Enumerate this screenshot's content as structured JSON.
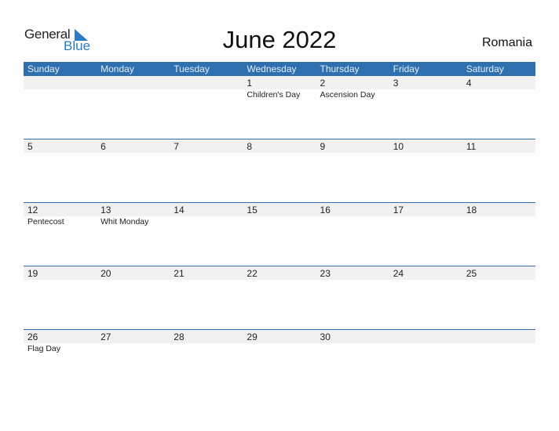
{
  "logo": {
    "line1": "General",
    "line2": "Blue"
  },
  "title": "June 2022",
  "country": "Romania",
  "colors": {
    "accent": "#2e6fb0",
    "band": "#f1f1f1",
    "logo_blue": "#2a7bc4"
  },
  "weekdays": [
    "Sunday",
    "Monday",
    "Tuesday",
    "Wednesday",
    "Thursday",
    "Friday",
    "Saturday"
  ],
  "weeks": [
    [
      {
        "day": "",
        "holiday": ""
      },
      {
        "day": "",
        "holiday": ""
      },
      {
        "day": "",
        "holiday": ""
      },
      {
        "day": "1",
        "holiday": "Children's Day"
      },
      {
        "day": "2",
        "holiday": "Ascension Day"
      },
      {
        "day": "3",
        "holiday": ""
      },
      {
        "day": "4",
        "holiday": ""
      }
    ],
    [
      {
        "day": "5",
        "holiday": ""
      },
      {
        "day": "6",
        "holiday": ""
      },
      {
        "day": "7",
        "holiday": ""
      },
      {
        "day": "8",
        "holiday": ""
      },
      {
        "day": "9",
        "holiday": ""
      },
      {
        "day": "10",
        "holiday": ""
      },
      {
        "day": "11",
        "holiday": ""
      }
    ],
    [
      {
        "day": "12",
        "holiday": "Pentecost"
      },
      {
        "day": "13",
        "holiday": "Whit Monday"
      },
      {
        "day": "14",
        "holiday": ""
      },
      {
        "day": "15",
        "holiday": ""
      },
      {
        "day": "16",
        "holiday": ""
      },
      {
        "day": "17",
        "holiday": ""
      },
      {
        "day": "18",
        "holiday": ""
      }
    ],
    [
      {
        "day": "19",
        "holiday": ""
      },
      {
        "day": "20",
        "holiday": ""
      },
      {
        "day": "21",
        "holiday": ""
      },
      {
        "day": "22",
        "holiday": ""
      },
      {
        "day": "23",
        "holiday": ""
      },
      {
        "day": "24",
        "holiday": ""
      },
      {
        "day": "25",
        "holiday": ""
      }
    ],
    [
      {
        "day": "26",
        "holiday": "Flag Day"
      },
      {
        "day": "27",
        "holiday": ""
      },
      {
        "day": "28",
        "holiday": ""
      },
      {
        "day": "29",
        "holiday": ""
      },
      {
        "day": "30",
        "holiday": ""
      },
      {
        "day": "",
        "holiday": ""
      },
      {
        "day": "",
        "holiday": ""
      }
    ]
  ]
}
